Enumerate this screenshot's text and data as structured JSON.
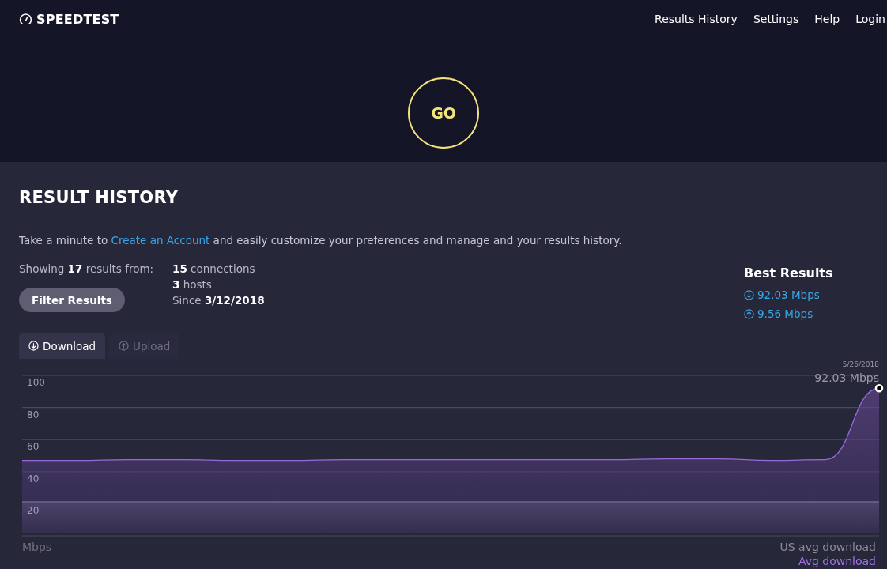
{
  "header": {
    "logo": "SPEEDTEST",
    "nav": [
      "Results History",
      "Settings",
      "Help",
      "Login"
    ]
  },
  "go_button": "GO",
  "section": {
    "title": "RESULT HISTORY",
    "intro": {
      "before": "Take a minute to",
      "link": "Create an Account",
      "after": "and easily customize your preferences and manage and your results history."
    },
    "showing": "Showing **17** results from:",
    "filter_button": "Filter Results",
    "sources": [
      "**15** connections",
      "**3** hosts",
      "Since **3/12/2018**"
    ],
    "best": {
      "title": "Best Results",
      "download": "92.03 Mbps",
      "upload": "9.56 Mbps"
    },
    "tabs": [
      {
        "label": "Download",
        "kind": "download",
        "selected": true
      },
      {
        "label": "Upload",
        "kind": "upload",
        "selected": false
      }
    ],
    "chart_unit": "Mbps",
    "point_callout": {
      "date": "5/26/2018",
      "value": "92.03 Mbps"
    },
    "chart_data": {
      "type": "area",
      "grid": true,
      "ylim": [
        0,
        100
      ],
      "yticks": [
        20,
        40,
        60,
        80,
        100
      ],
      "series": [
        {
          "name": "US avg download",
          "color": "#8d8b9c",
          "values": [
            21,
            21,
            21,
            21,
            21,
            21,
            21,
            21,
            21,
            21,
            21,
            21,
            21,
            21,
            21,
            21,
            21
          ]
        },
        {
          "name": "Avg download",
          "color": "#a271e8",
          "values": [
            47,
            47,
            47.5,
            47.5,
            47,
            47,
            47.5,
            47.5,
            47.5,
            47.5,
            47.5,
            47.5,
            48,
            48,
            47,
            47.5,
            92
          ]
        }
      ]
    }
  }
}
